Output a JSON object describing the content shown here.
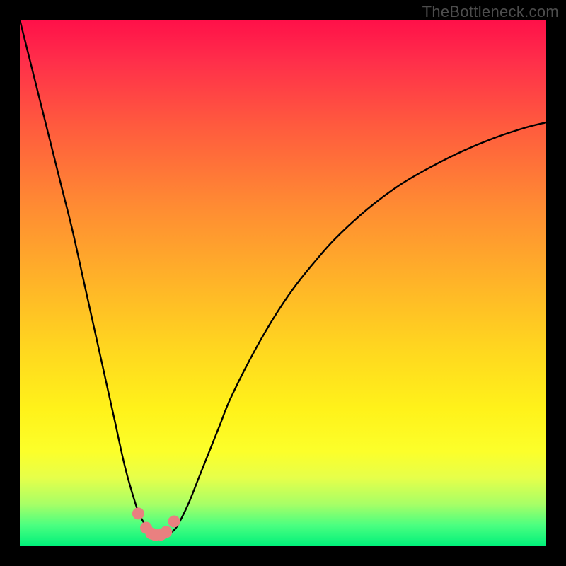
{
  "watermark": "TheBottleneck.com",
  "colors": {
    "frame": "#000000",
    "curve_stroke": "#000000",
    "marker_fill": "#e98080",
    "marker_stroke": "#7a2f2f",
    "gradient_top": "#ff1049",
    "gradient_bottom": "#00f07a"
  },
  "chart_data": {
    "type": "line",
    "title": "",
    "xlabel": "",
    "ylabel": "",
    "xlim": [
      0,
      100
    ],
    "ylim": [
      0,
      100
    ],
    "series": [
      {
        "name": "bottleneck-curve",
        "x": [
          0,
          2,
          4,
          6,
          8,
          10,
          12,
          14,
          16,
          18,
          20,
          22,
          23,
          24,
          25,
          26,
          27,
          28,
          29,
          30,
          32,
          34,
          36,
          38,
          40,
          44,
          48,
          52,
          56,
          60,
          66,
          72,
          78,
          84,
          90,
          96,
          100
        ],
        "y": [
          100,
          92,
          84,
          76,
          68,
          60,
          51,
          42,
          33,
          24,
          15,
          8,
          5.5,
          3.8,
          2.6,
          2.1,
          2.0,
          2.2,
          2.8,
          4.0,
          8,
          13,
          18,
          23,
          28,
          36,
          43,
          49,
          54,
          58.5,
          64,
          68.5,
          72,
          75,
          77.5,
          79.5,
          80.5
        ]
      }
    ],
    "markers": {
      "name": "near-minimum-points",
      "x": [
        22.5,
        24.0,
        25.0,
        25.8,
        26.8,
        27.8,
        29.3
      ],
      "y": [
        6.2,
        3.5,
        2.4,
        2.1,
        2.2,
        2.7,
        4.7
      ]
    }
  }
}
